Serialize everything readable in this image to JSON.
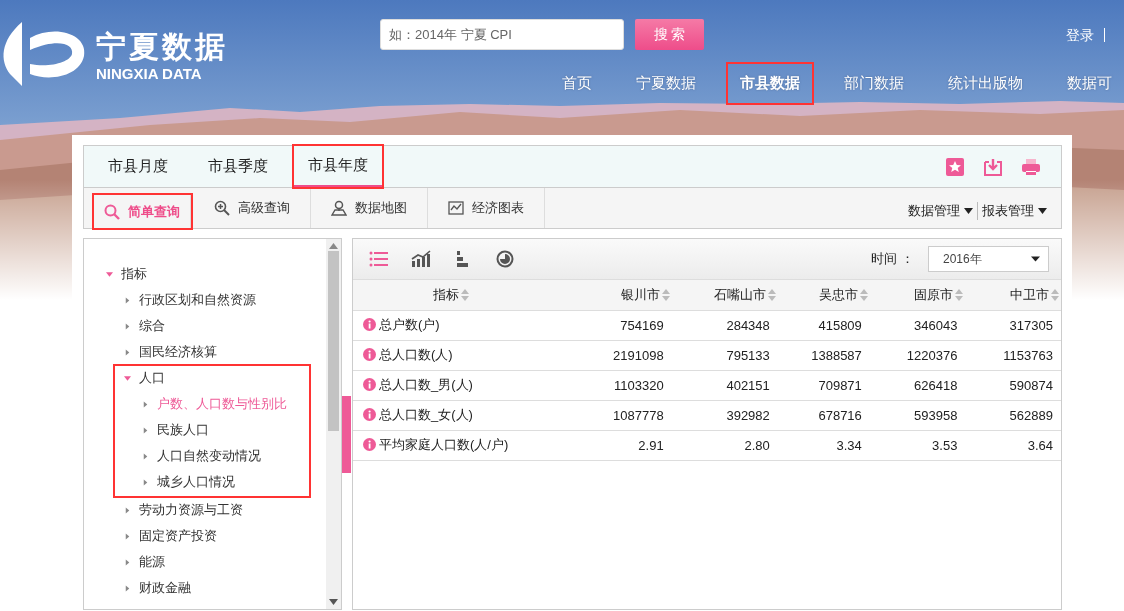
{
  "header": {
    "logo": {
      "title": "宁夏数据",
      "subtitle": "NINGXIA DATA"
    },
    "search": {
      "placeholder": "如：2014年 宁夏 CPI",
      "button": "搜 索"
    },
    "user_links": [
      "登录"
    ],
    "nav": [
      {
        "label": "首页",
        "selected": false,
        "highlighted": false
      },
      {
        "label": "宁夏数据",
        "selected": false,
        "highlighted": false
      },
      {
        "label": "市县数据",
        "selected": true,
        "highlighted": true
      },
      {
        "label": "部门数据",
        "selected": false,
        "highlighted": false
      },
      {
        "label": "统计出版物",
        "selected": false,
        "highlighted": false
      },
      {
        "label": "数据可",
        "selected": false,
        "highlighted": false
      }
    ]
  },
  "tabs": [
    {
      "label": "市县月度",
      "selected": false,
      "highlighted": false
    },
    {
      "label": "市县季度",
      "selected": false,
      "highlighted": false
    },
    {
      "label": "市县年度",
      "selected": true,
      "highlighted": true
    }
  ],
  "tools": [
    {
      "label": "简单查询",
      "kind": "search",
      "selected": true,
      "highlighted": true
    },
    {
      "label": "高级查询",
      "kind": "zoom",
      "selected": false,
      "highlighted": false
    },
    {
      "label": "数据地图",
      "kind": "map",
      "selected": false,
      "highlighted": false
    },
    {
      "label": "经济图表",
      "kind": "chart",
      "selected": false,
      "highlighted": false
    }
  ],
  "menus": [
    "数据管理",
    "报表管理"
  ],
  "tree": [
    {
      "label": "指标",
      "expanded": true,
      "selected": false,
      "highlighted": false,
      "children": [
        {
          "label": "行政区划和自然资源",
          "expanded": false,
          "selected": false,
          "highlighted": false
        },
        {
          "label": "综合",
          "expanded": false,
          "selected": false,
          "highlighted": false
        },
        {
          "label": "国民经济核算",
          "expanded": false,
          "selected": false,
          "highlighted": false
        },
        {
          "label": "人口",
          "expanded": true,
          "selected": false,
          "highlighted": true,
          "children": [
            {
              "label": "户数、人口数与性别比",
              "expanded": false,
              "selected": true,
              "highlighted": false
            },
            {
              "label": "民族人口",
              "expanded": false,
              "selected": false,
              "highlighted": false
            },
            {
              "label": "人口自然变动情况",
              "expanded": false,
              "selected": false,
              "highlighted": false
            },
            {
              "label": "城乡人口情况",
              "expanded": false,
              "selected": false,
              "highlighted": false
            }
          ]
        },
        {
          "label": "劳动力资源与工资",
          "expanded": false,
          "selected": false,
          "highlighted": false
        },
        {
          "label": "固定资产投资",
          "expanded": false,
          "selected": false,
          "highlighted": false
        },
        {
          "label": "能源",
          "expanded": false,
          "selected": false,
          "highlighted": false
        },
        {
          "label": "财政金融",
          "expanded": false,
          "selected": false,
          "highlighted": false
        }
      ]
    }
  ],
  "views": [
    {
      "kind": "table",
      "selected": true
    },
    {
      "kind": "line",
      "selected": false
    },
    {
      "kind": "bar",
      "selected": false
    },
    {
      "kind": "pie",
      "selected": false
    }
  ],
  "time": {
    "label": "时间 ：",
    "value": "2016年"
  },
  "table": {
    "columns": [
      "指标",
      "银川市",
      "石嘴山市",
      "吴忠市",
      "固原市",
      "中卫市"
    ],
    "rows": [
      [
        "总户数(户)",
        "754169",
        "284348",
        "415809",
        "346043",
        "317305"
      ],
      [
        "总人口数(人)",
        "2191098",
        "795133",
        "1388587",
        "1220376",
        "1153763"
      ],
      [
        "总人口数_男(人)",
        "1103320",
        "402151",
        "709871",
        "626418",
        "590874"
      ],
      [
        "总人口数_女(人)",
        "1087778",
        "392982",
        "678716",
        "593958",
        "562889"
      ],
      [
        "平均家庭人口数(人/户)",
        "2.91",
        "2.80",
        "3.34",
        "3.53",
        "3.64"
      ]
    ]
  }
}
